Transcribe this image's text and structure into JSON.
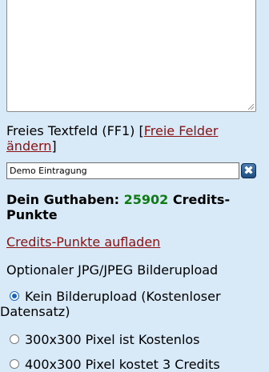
{
  "free_field": {
    "label_prefix": "Freies Textfeld (FF1) [",
    "link": "Freie Felder ändern",
    "label_suffix": "]",
    "input_value": "Demo Eintragung",
    "clear_icon": "✖"
  },
  "balance": {
    "prefix": "Dein Guthaben:",
    "amount": "25902",
    "suffix": "Credits-Punkte"
  },
  "credits_link": "Credits-Punkte aufladen",
  "upload": {
    "label": "Optionaler JPG/JPEG Bilderupload",
    "options": [
      {
        "label_line1": "Kein Bilderupload (Kostenloser",
        "label_line2": "Datensatz)",
        "checked": true
      },
      {
        "label": "300x300 Pixel ist Kostenlos",
        "checked": false
      },
      {
        "label": "400x300 Pixel kostet 3 Credits",
        "checked": false
      }
    ]
  }
}
